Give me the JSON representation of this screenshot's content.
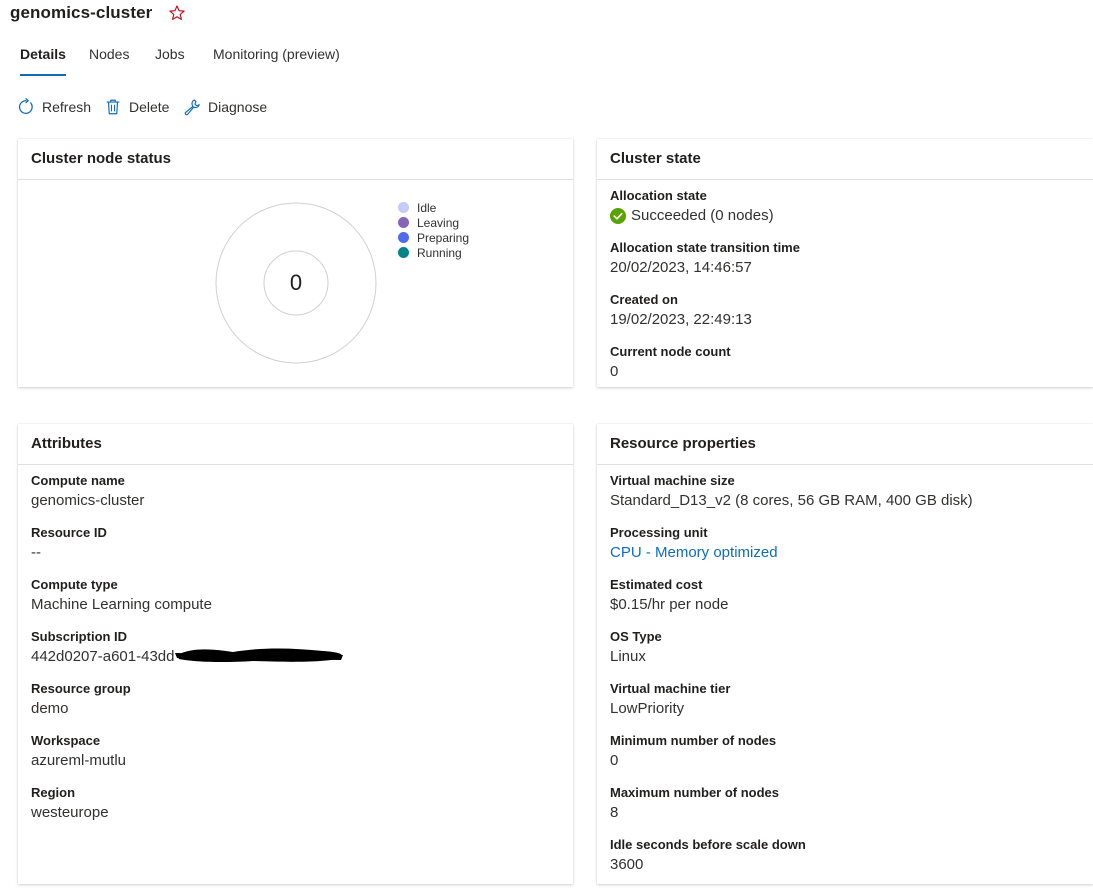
{
  "page": {
    "title": "genomics-cluster"
  },
  "tabs": [
    {
      "label": "Details",
      "active": true
    },
    {
      "label": "Nodes",
      "active": false
    },
    {
      "label": "Jobs",
      "active": false
    },
    {
      "label": "Monitoring (preview)",
      "active": false
    }
  ],
  "toolbar": {
    "refresh": {
      "label": "Refresh",
      "icon": "refresh-icon"
    },
    "delete": {
      "label": "Delete",
      "icon": "trash-icon"
    },
    "diagnose": {
      "label": "Diagnose",
      "icon": "wrench-icon"
    }
  },
  "node_status": {
    "title": "Cluster node status",
    "total": "0",
    "legend": [
      {
        "label": "Idle",
        "color": "#c5cbfa"
      },
      {
        "label": "Leaving",
        "color": "#8764b8"
      },
      {
        "label": "Preparing",
        "color": "#4f6bed"
      },
      {
        "label": "Running",
        "color": "#038387"
      }
    ]
  },
  "cluster_state": {
    "title": "Cluster state",
    "allocation_state": {
      "label": "Allocation state",
      "value": "Succeeded (0 nodes)",
      "icon": "success-check-icon",
      "color": "#57a300"
    },
    "transition_time": {
      "label": "Allocation state transition time",
      "value": "20/02/2023, 14:46:57"
    },
    "created_on": {
      "label": "Created on",
      "value": "19/02/2023, 22:49:13"
    },
    "node_count": {
      "label": "Current node count",
      "value": "0"
    }
  },
  "attributes": {
    "title": "Attributes",
    "items": [
      {
        "label": "Compute name",
        "value": "genomics-cluster"
      },
      {
        "label": "Resource ID",
        "value": "--"
      },
      {
        "label": "Compute type",
        "value": "Machine Learning compute"
      },
      {
        "label": "Subscription ID",
        "value": "442d0207-a601-43dd"
      },
      {
        "label": "Resource group",
        "value": "demo"
      },
      {
        "label": "Workspace",
        "value": "azureml-mutlu"
      },
      {
        "label": "Region",
        "value": "westeurope"
      }
    ]
  },
  "resource_properties": {
    "title": "Resource properties",
    "items": [
      {
        "label": "Virtual machine size",
        "value": "Standard_D13_v2 (8 cores, 56 GB RAM, 400 GB disk)"
      },
      {
        "label": "Processing unit",
        "value": "CPU - Memory optimized",
        "link": true
      },
      {
        "label": "Estimated cost",
        "value": "$0.15/hr per node"
      },
      {
        "label": "OS Type",
        "value": "Linux"
      },
      {
        "label": "Virtual machine tier",
        "value": "LowPriority"
      },
      {
        "label": "Minimum number of nodes",
        "value": "0"
      },
      {
        "label": "Maximum number of nodes",
        "value": "8"
      },
      {
        "label": "Idle seconds before scale down",
        "value": "3600"
      }
    ]
  },
  "colors": {
    "accent": "#0f6cbd",
    "star": "#c50f1f",
    "link": "#0f6cbd"
  }
}
